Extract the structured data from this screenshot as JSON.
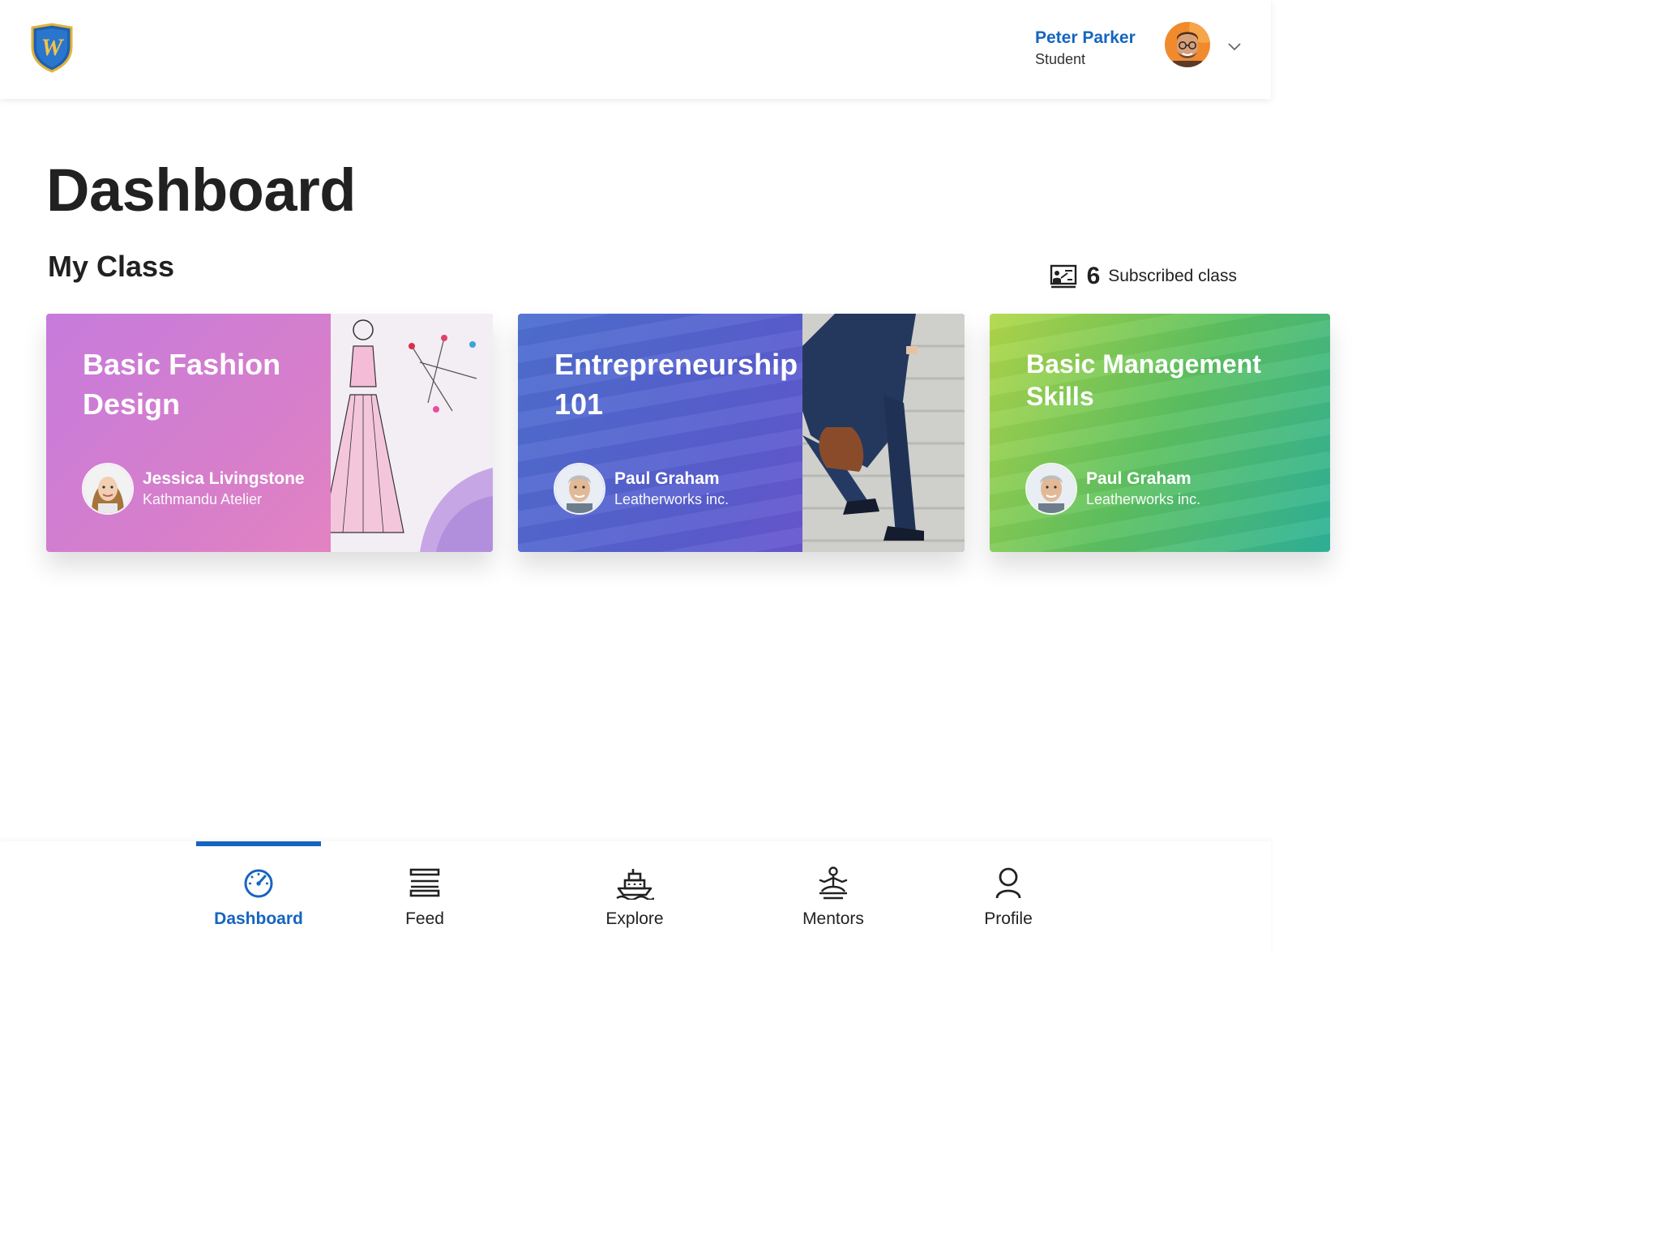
{
  "header": {
    "logo_letter": "W",
    "user_name": "Peter Parker",
    "user_role": "Student"
  },
  "page_title": "Dashboard",
  "my_class": {
    "title": "My Class",
    "subscribed_count": "6",
    "subscribed_label": "Subscribed class"
  },
  "cards": [
    {
      "title": "Basic Fashion Design",
      "mentor_name": "Jessica Livingstone",
      "mentor_org": "Kathmandu Atelier"
    },
    {
      "title": "Entrepreneurship 101",
      "mentor_name": "Paul Graham",
      "mentor_org": "Leatherworks inc."
    },
    {
      "title": "Basic Management Skills",
      "mentor_name": "Paul Graham",
      "mentor_org": "Leatherworks inc."
    }
  ],
  "nav": [
    {
      "label": "Dashboard",
      "active": true
    },
    {
      "label": "Feed"
    },
    {
      "label": "Explore"
    },
    {
      "label": "Mentors"
    },
    {
      "label": "Profile"
    }
  ],
  "colors": {
    "accent": "#1565c0",
    "fashion_card": "#d27fd0",
    "entrepreneurship_card": "#5a5ed0",
    "management_card": "#6ec25a"
  }
}
